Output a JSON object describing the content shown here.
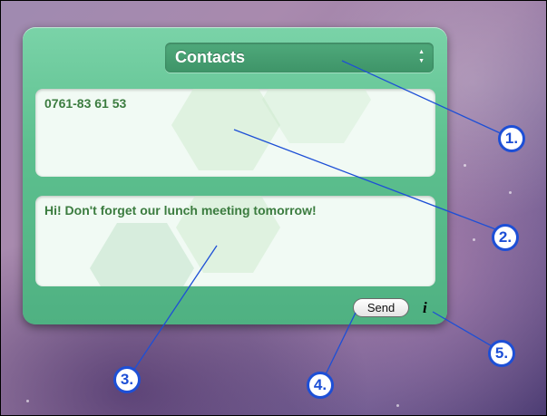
{
  "widget": {
    "contacts_select": {
      "selected": "Contacts",
      "arrows_up": "▲",
      "arrows_down": "▼"
    },
    "number_field": {
      "value": "0761-83 61 53"
    },
    "message_field": {
      "value": "Hi! Don't forget our lunch meeting tomorrow!"
    },
    "send_label": "Send",
    "info_label": "i"
  },
  "callouts": [
    "1.",
    "2.",
    "3.",
    "4.",
    "5."
  ],
  "colors": {
    "widget_green": "#5dc08f",
    "text_green": "#3b7c3f",
    "callout_blue": "#1d4fd6"
  },
  "icons": [
    "info-icon",
    "select-arrows-icon"
  ]
}
